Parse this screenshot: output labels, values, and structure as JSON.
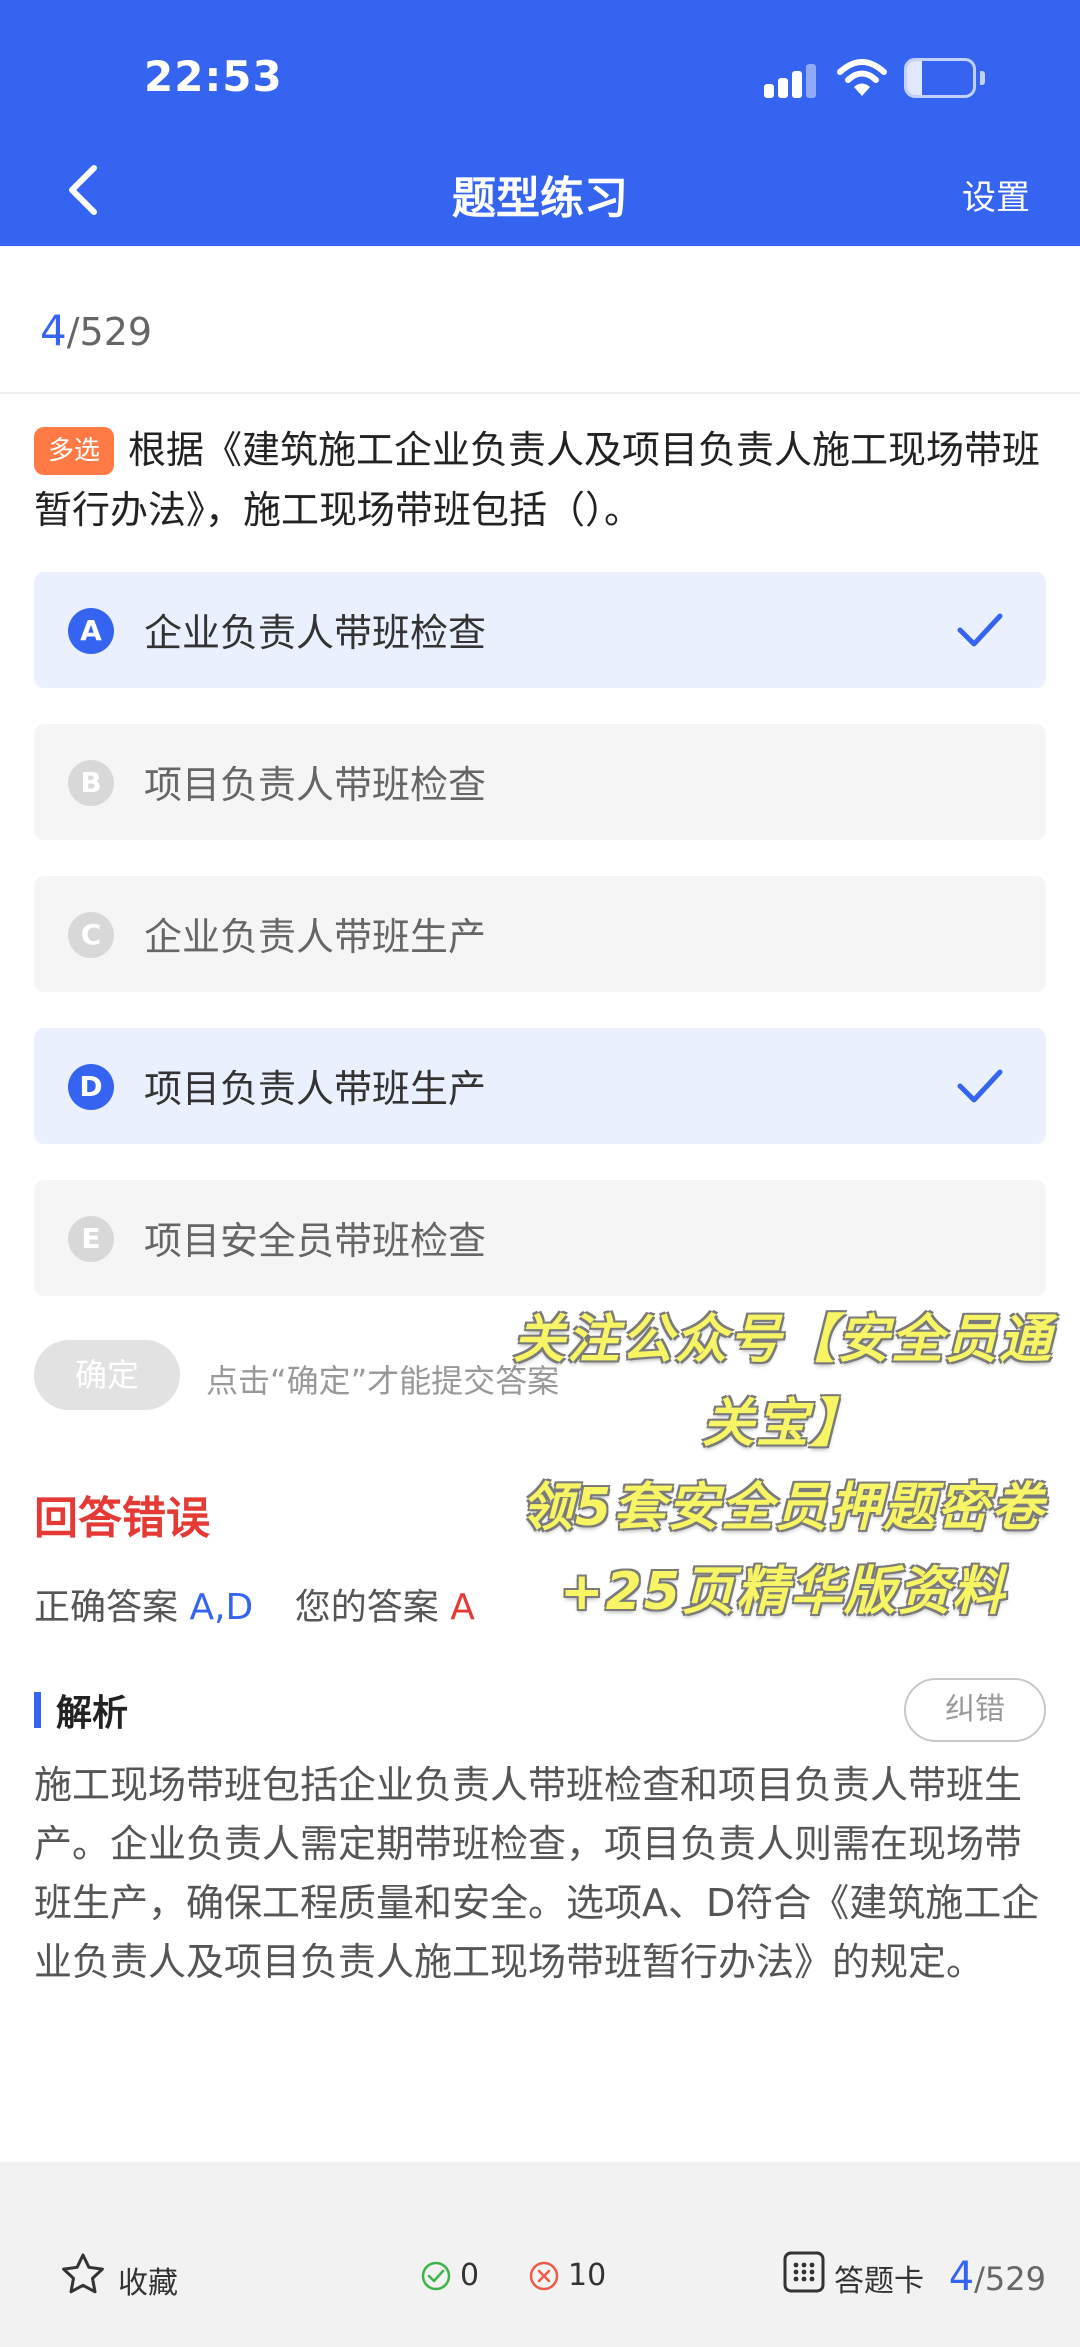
{
  "status_bar": {
    "time": "22:53",
    "battery": "23",
    "battery_level": 0.23
  },
  "nav": {
    "title": "题型练习",
    "settings_label": "设置"
  },
  "progress": {
    "current": "4",
    "total": "/529"
  },
  "question": {
    "tag": "多选",
    "text": "根据《建筑施工企业负责人及项目负责人施工现场带班暂行办法》，施工现场带班包括（）。"
  },
  "options": [
    {
      "letter": "A",
      "text": "企业负责人带班检查",
      "selected": true
    },
    {
      "letter": "B",
      "text": "项目负责人带班检查",
      "selected": false
    },
    {
      "letter": "C",
      "text": "企业负责人带班生产",
      "selected": false
    },
    {
      "letter": "D",
      "text": "项目负责人带班生产",
      "selected": true
    },
    {
      "letter": "E",
      "text": "项目安全员带班检查",
      "selected": false
    }
  ],
  "confirm": {
    "label": "确定",
    "hint": "点击“确定”才能提交答案"
  },
  "promo": {
    "line1": "关注公众号【安全员通",
    "line2": "关宝】",
    "line3": "领5套安全员押题密卷",
    "line4": "+25页精华版资料"
  },
  "result": {
    "title": "回答错误",
    "correct_label": "正确答案",
    "correct_value": "A,D",
    "mine_label": "您的答案",
    "mine_value": "A"
  },
  "analysis": {
    "title": "解析",
    "report_label": "纠错",
    "body": "施工现场带班包括企业负责人带班检查和项目负责人带班生产。企业负责人需定期带班检查，项目负责人则需在现场带班生产，确保工程质量和安全。选项A、D符合《建筑施工企业负责人及项目负责人施工现场带班暂行办法》的规定。"
  },
  "footer": {
    "favorite_label": "收藏",
    "correct_count": "0",
    "wrong_count": "10",
    "answer_card_label": "答题卡",
    "current": "4",
    "total": "/529"
  },
  "colors": {
    "primary": "#3564f0",
    "error": "#e53935",
    "tag": "#ff7a45",
    "promo": "#f8f564"
  }
}
